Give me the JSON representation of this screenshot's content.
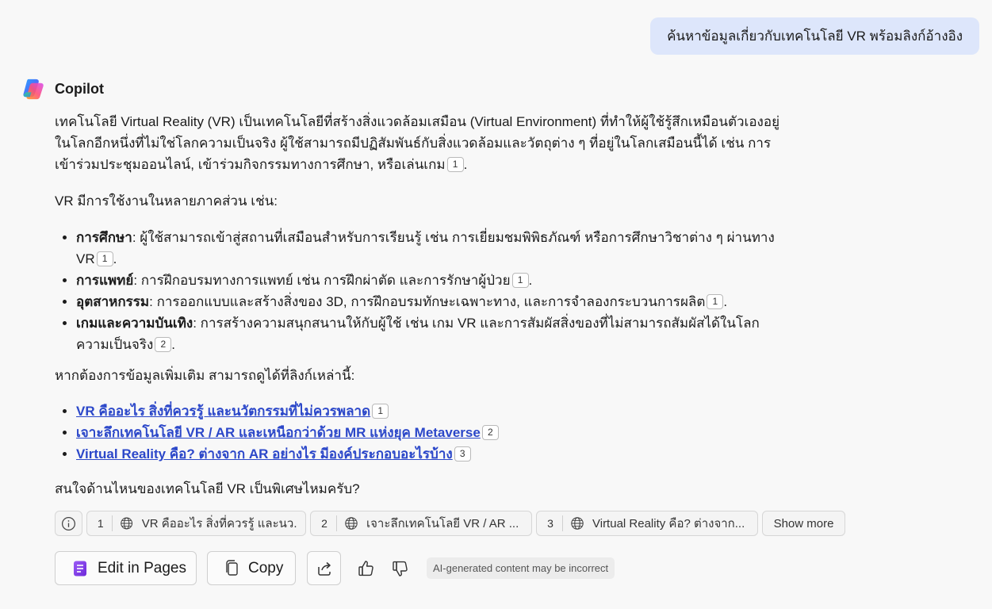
{
  "user_message": "ค้นหาข้อมูลเกี่ยวกับเทคโนโลยี VR พร้อมลิงก์อ้างอิง",
  "bot": {
    "name": "Copilot",
    "logo_icon": "copilot-logo-icon"
  },
  "answer": {
    "para1": {
      "text": "เทคโนโลยี Virtual Reality (VR) เป็นเทคโนโลยีที่สร้างสิ่งแวดล้อมเสมือน (Virtual Environment) ที่ทำให้ผู้ใช้รู้สึกเหมือนตัวเองอยู่ในโลกอีกหนึ่งที่ไม่ใช่โลกความเป็นจริง ผู้ใช้สามารถมีปฏิสัมพันธ์กับสิ่งแวดล้อมและวัตถุต่าง ๆ ที่อยู่ในโลกเสมือนนี้ได้ เช่น การเข้าร่วมประชุมออนไลน์, เข้าร่วมกิจกรรมทางการศึกษา, หรือเล่นเกม",
      "cite": "1"
    },
    "para2": "VR มีการใช้งานในหลายภาคส่วน เช่น:",
    "uses": [
      {
        "title": "การศึกษา",
        "text": ": ผู้ใช้สามารถเข้าสู่สถานที่เสมือนสำหรับการเรียนรู้ เช่น การเยี่ยมชมพิพิธภัณฑ์ หรือการศึกษาวิชาต่าง ๆ ผ่านทาง VR",
        "cite": "1"
      },
      {
        "title": "การแพทย์",
        "text": ": การฝึกอบรมทางการแพทย์ เช่น การฝึกผ่าตัด และการรักษาผู้ป่วย",
        "cite": "1"
      },
      {
        "title": "อุตสาหกรรม",
        "text": ": การออกแบบและสร้างสิ่งของ 3D, การฝึกอบรมทักษะเฉพาะทาง, และการจำลองกระบวนการผลิต",
        "cite": "1"
      },
      {
        "title": "เกมและความบันเทิง",
        "text": ": การสร้างความสนุกสนานให้กับผู้ใช้ เช่น เกม VR และการสัมผัสสิ่งของที่ไม่สามารถสัมผัสได้ในโลกความเป็นจริง",
        "cite": "2"
      }
    ],
    "para3": "หากต้องการข้อมูลเพิ่มเติม สามารถดูได้ที่ลิงก์เหล่านี้:",
    "links": [
      {
        "text": "VR คืออะไร สิ่งที่ควรรู้ และนวัตกรรมที่ไม่ควรพลาด",
        "cite": "1"
      },
      {
        "text": "เจาะลึกเทคโนโลยี VR / AR และเหนือกว่าด้วย MR แห่งยุค Metaverse",
        "cite": "2"
      },
      {
        "text": "Virtual Reality คือ? ต่างจาก AR อย่างไร มีองค์ประกอบอะไรบ้าง",
        "cite": "3"
      }
    ],
    "para4": "สนใจด้านไหนของเทคโนโลยี VR เป็นพิเศษไหมครับ?"
  },
  "sources": [
    {
      "num": "1",
      "text": "VR คืออะไร สิ่งที่ควรรู้ และนว..."
    },
    {
      "num": "2",
      "text": "เจาะลึกเทคโนโลยี VR / AR ..."
    },
    {
      "num": "3",
      "text": "Virtual Reality คือ? ต่างจาก..."
    }
  ],
  "show_more": "Show more",
  "actions": {
    "edit_label": "Edit in Pages",
    "copy_label": "Copy"
  },
  "disclaimer": "AI-generated content may be incorrect",
  "colors": {
    "user_bubble": "#dde6fb",
    "link": "#2b47c9",
    "background": "#f8f8f8"
  }
}
